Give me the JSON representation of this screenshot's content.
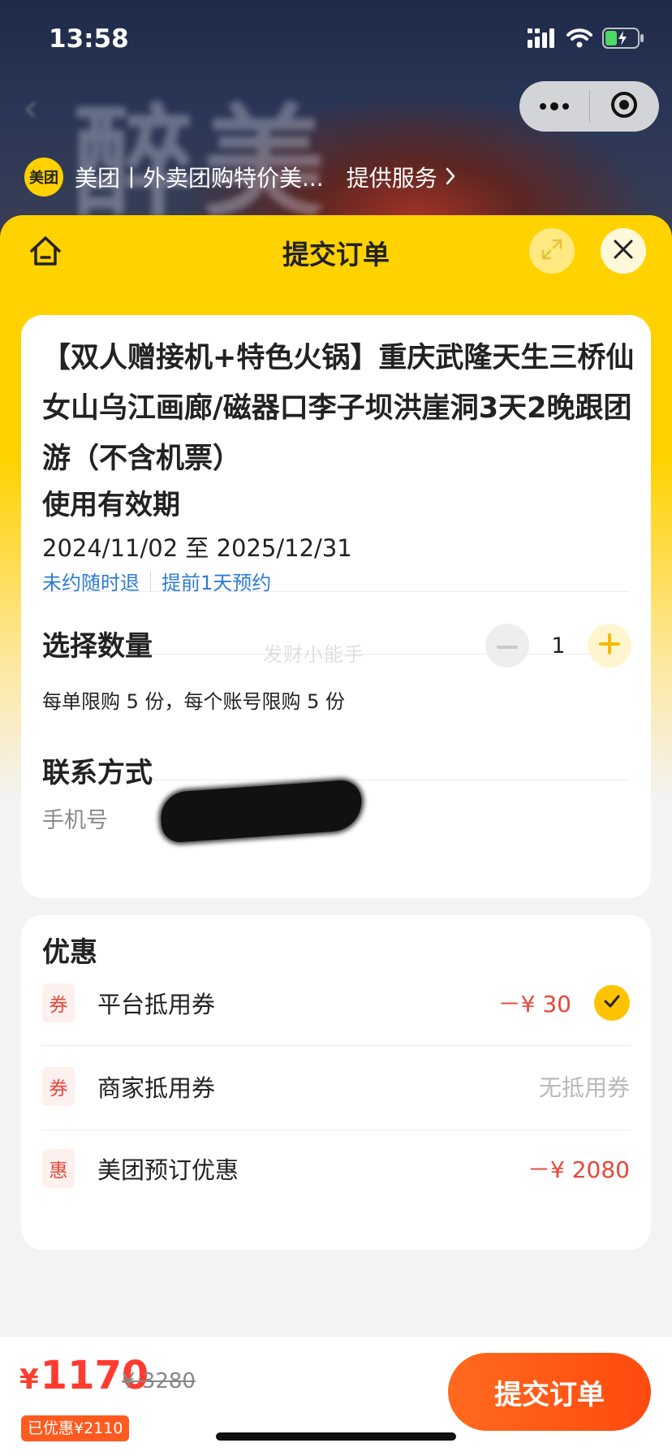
{
  "status_bar": {
    "time": "13:58"
  },
  "background": {
    "art_text": "醉美",
    "back_glyph": "‹"
  },
  "mini_program": {
    "logo_text": "美团",
    "name": "美团丨外卖团购特价美...",
    "service_label": "提供服务"
  },
  "sheet": {
    "title": "提交订单"
  },
  "product": {
    "title": "【双人赠接机+特色火锅】重庆武隆天生三桥仙女山乌江画廊/磁器口李子坝洪崖洞3天2晚跟团游（不含机票）"
  },
  "validity": {
    "heading": "使用有效期",
    "dates": "2024/11/02 至 2025/12/31",
    "tag_refund": "未约随时退",
    "tag_booking": "提前1天预约"
  },
  "quantity": {
    "heading": "选择数量",
    "value": "1",
    "limit_text": "每单限购 5 份，每个账号限购 5 份",
    "watermark": "发财小能手"
  },
  "contact": {
    "heading": "联系方式",
    "phone_label": "手机号"
  },
  "promotions": {
    "heading": "优惠",
    "items": [
      {
        "badge": "券",
        "label": "平台抵用券",
        "value": "－¥ 30",
        "checked": true
      },
      {
        "badge": "券",
        "label": "商家抵用券",
        "value": "无抵用券",
        "checked": false
      },
      {
        "badge": "惠",
        "label": "美团预订优惠",
        "value": "－¥ 2080",
        "checked": false
      }
    ]
  },
  "footer": {
    "currency": "¥",
    "price": "1170",
    "original_price": "¥ 3280",
    "discount_tag": "已优惠¥2110",
    "submit_label": "提交订单"
  },
  "colors": {
    "brand_yellow": "#ffd200",
    "price_red": "#ff3b2f",
    "link_blue": "#2d7bd6",
    "submit_orange": "#ff5a1f"
  }
}
